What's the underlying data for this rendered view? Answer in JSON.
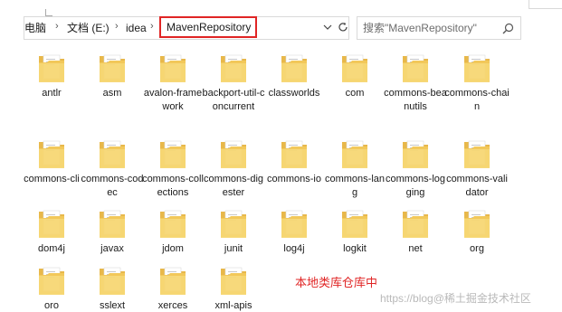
{
  "address_bar": {
    "breadcrumbs": [
      "电脑",
      "文档 (E:)",
      "idea"
    ],
    "current": "MavenRepository"
  },
  "search": {
    "placeholder": "搜索\"MavenRepository\""
  },
  "folders": [
    {
      "label": "antlr"
    },
    {
      "label": "asm"
    },
    {
      "label": "avalon-framework"
    },
    {
      "label": "backport-util-concurrent"
    },
    {
      "label": "classworlds"
    },
    {
      "label": "com"
    },
    {
      "label": "commons-beanutils"
    },
    {
      "label": "commons-chain"
    },
    {
      "label": "commons-cli"
    },
    {
      "label": "commons-codec"
    },
    {
      "label": "commons-collections"
    },
    {
      "label": "commons-digester"
    },
    {
      "label": "commons-io"
    },
    {
      "label": "commons-lang"
    },
    {
      "label": "commons-logging"
    },
    {
      "label": "commons-validator"
    },
    {
      "label": "dom4j"
    },
    {
      "label": "javax"
    },
    {
      "label": "jdom"
    },
    {
      "label": "junit"
    },
    {
      "label": "log4j"
    },
    {
      "label": "logkit"
    },
    {
      "label": "net"
    },
    {
      "label": "org"
    },
    {
      "label": "oro"
    },
    {
      "label": "sslext"
    },
    {
      "label": "xerces"
    },
    {
      "label": "xml-apis"
    }
  ],
  "annotation": "本地类库仓库中",
  "watermark": "https://blog@稀土掘金技术社区",
  "colors": {
    "highlight_border": "#e02525",
    "annotation_text": "#e02525",
    "folder_body": "#f7d774",
    "folder_back": "#e8b84a"
  },
  "icons": {
    "folder": "folder-icon",
    "search": "search-icon",
    "dropdown": "chevron-down-icon",
    "refresh": "refresh-icon"
  }
}
